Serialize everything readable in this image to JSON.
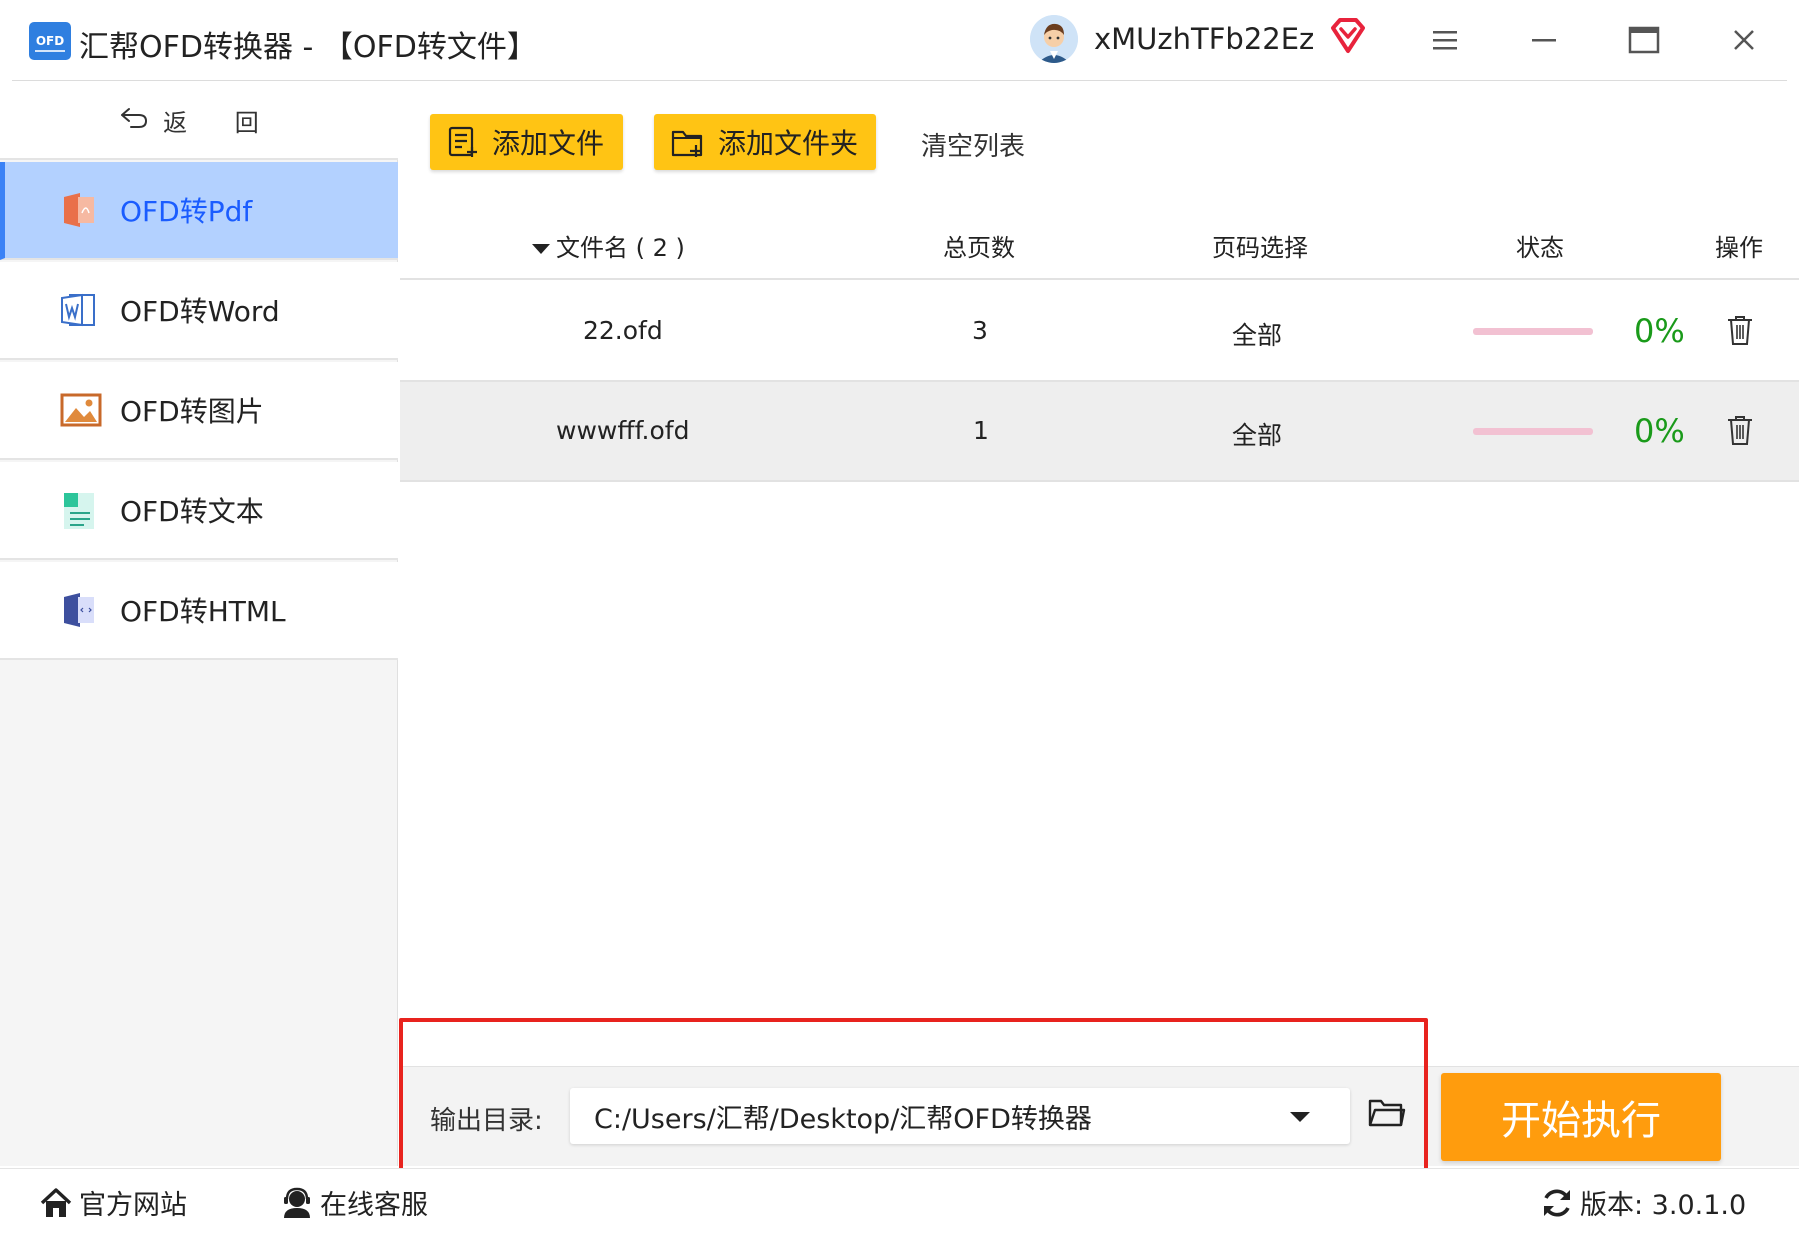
{
  "window": {
    "logo_text": "OFD",
    "title": "汇帮OFD转换器 - 【OFD转文件】",
    "username": "xMUzhTFb22Ez"
  },
  "sidebar": {
    "back_label": "返 回",
    "items": [
      {
        "label": "OFD转Pdf",
        "icon": "pdf-icon",
        "active": true
      },
      {
        "label": "OFD转Word",
        "icon": "word-icon",
        "active": false
      },
      {
        "label": "OFD转图片",
        "icon": "image-icon",
        "active": false
      },
      {
        "label": "OFD转文本",
        "icon": "text-icon",
        "active": false
      },
      {
        "label": "OFD转HTML",
        "icon": "html-icon",
        "active": false
      }
    ]
  },
  "toolbar": {
    "add_file": "添加文件",
    "add_folder": "添加文件夹",
    "clear_list": "清空列表"
  },
  "table": {
    "headers": {
      "filename": "文件名 ( 2 )",
      "pages": "总页数",
      "page_select": "页码选择",
      "status": "状态",
      "actions": "操作"
    },
    "rows": [
      {
        "filename": "22.ofd",
        "pages": "3",
        "page_select": "全部",
        "progress": "0%"
      },
      {
        "filename": "wwwfff.ofd",
        "pages": "1",
        "page_select": "全部",
        "progress": "0%"
      }
    ]
  },
  "output": {
    "label": "输出目录:",
    "path": "C:/Users/汇帮/Desktop/汇帮OFD转换器"
  },
  "start_button": "开始执行",
  "statusbar": {
    "website": "官方网站",
    "support": "在线客服",
    "version": "版本: 3.0.1.0"
  },
  "colors": {
    "accent_yellow": "#ffc414",
    "start_orange": "#ff9c0d",
    "active_nav_bg": "#b3d1ff",
    "active_nav_text": "#1a5cff",
    "progress_green": "#1a9a1a",
    "highlight_red": "#e8231e"
  }
}
